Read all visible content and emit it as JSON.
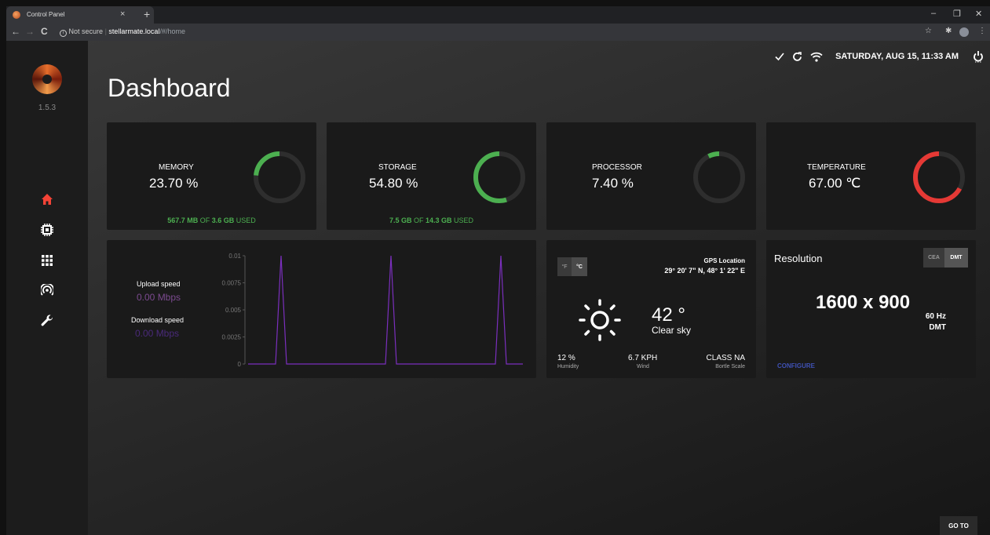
{
  "browser": {
    "tab_title": "Control Panel",
    "close_glyph": "×",
    "new_tab_glyph": "+",
    "minimize_glyph": "–",
    "restore_glyph": "❐",
    "window_close_glyph": "✕",
    "back_glyph": "←",
    "forward_glyph": "→",
    "reload_glyph": "C",
    "security": "Not secure",
    "url_host": "stellarmate.local",
    "url_path": "/#/home",
    "star_glyph": "☆",
    "ext_glyph": "✱",
    "menu_glyph": "⋮",
    "icons": [
      "info-icon",
      "star-icon",
      "puzzle-icon",
      "profile-icon",
      "kebab-menu-icon"
    ]
  },
  "sidebar": {
    "version": "1.5.3",
    "items": [
      {
        "name": "home",
        "icon": "home-icon",
        "active": true
      },
      {
        "name": "cpu",
        "icon": "chip-icon"
      },
      {
        "name": "apps",
        "icon": "grid-icon"
      },
      {
        "name": "network",
        "icon": "hotspot-icon"
      },
      {
        "name": "tools",
        "icon": "wrench-icon"
      }
    ],
    "accent": "#f44336"
  },
  "status": {
    "datetime": "SATURDAY, AUG 15, 11:33 AM",
    "icons": [
      "check-icon",
      "sync-icon",
      "wifi-icon",
      "power-icon"
    ]
  },
  "page": {
    "title": "Dashboard"
  },
  "stats": [
    {
      "label": "MEMORY",
      "value": "23.70 %",
      "percent": 23.7,
      "color": "#4caf50",
      "sub_used": "567.7 MB",
      "sub_of": " OF ",
      "sub_total": "3.6 GB",
      "sub_tail": " USED"
    },
    {
      "label": "STORAGE",
      "value": "54.80 %",
      "percent": 54.8,
      "color": "#4caf50",
      "sub_used": "7.5 GB",
      "sub_of": " OF ",
      "sub_total": "14.3 GB",
      "sub_tail": " USED"
    },
    {
      "label": "PROCESSOR",
      "value": "7.40 %",
      "percent": 7.4,
      "color": "#4caf50"
    },
    {
      "label": "TEMPERATURE",
      "value": "67.00 ℃",
      "percent": 67,
      "color": "#e53935"
    }
  ],
  "network": {
    "upload_label": "Upload speed",
    "upload_value": "0.00 Mbps",
    "download_label": "Download speed",
    "download_value": "0.00 Mbps",
    "upload_color": "#7b4a8f",
    "download_color": "#4a2a7a"
  },
  "chart_data": {
    "type": "line",
    "title": "",
    "xlabel": "",
    "ylabel": "",
    "yticks": [
      "0",
      "0.0025",
      "0.005",
      "0.0075",
      "0.01"
    ],
    "ylim": [
      0,
      0.01
    ],
    "x": [
      0,
      10,
      11,
      12,
      13,
      14,
      50,
      51,
      52,
      53,
      54,
      90,
      91,
      92,
      93,
      94,
      100
    ],
    "series": [
      {
        "color": "#7b2fbe",
        "values": [
          0,
          0,
          0.005,
          0.01,
          0.005,
          0,
          0,
          0.005,
          0.01,
          0.005,
          0,
          0,
          0.005,
          0.01,
          0.005,
          0,
          0
        ]
      }
    ],
    "grid": false
  },
  "weather": {
    "unit_f": "°F",
    "unit_c": "°C",
    "active_unit": "C",
    "gps_label": "GPS Location",
    "gps_coords": "29° 20' 7\" N, 48° 1' 22\" E",
    "temp": "42 °",
    "condition": "Clear sky",
    "humidity_value": "12 %",
    "humidity_label": "Humidity",
    "wind_value": "6.7 KPH",
    "wind_label": "Wind",
    "bortle_value": "CLASS NA",
    "bortle_label": "Bortle Scale",
    "icon": "sun-icon"
  },
  "resolution": {
    "title": "Resolution",
    "cea": "CEA",
    "dmt": "DMT",
    "active_mode": "DMT",
    "value": "1600 x 900",
    "refresh": "60 Hz",
    "mode": "DMT",
    "configure": "CONFIGURE",
    "configure_color": "#3f51b5"
  },
  "goto": "GO TO"
}
